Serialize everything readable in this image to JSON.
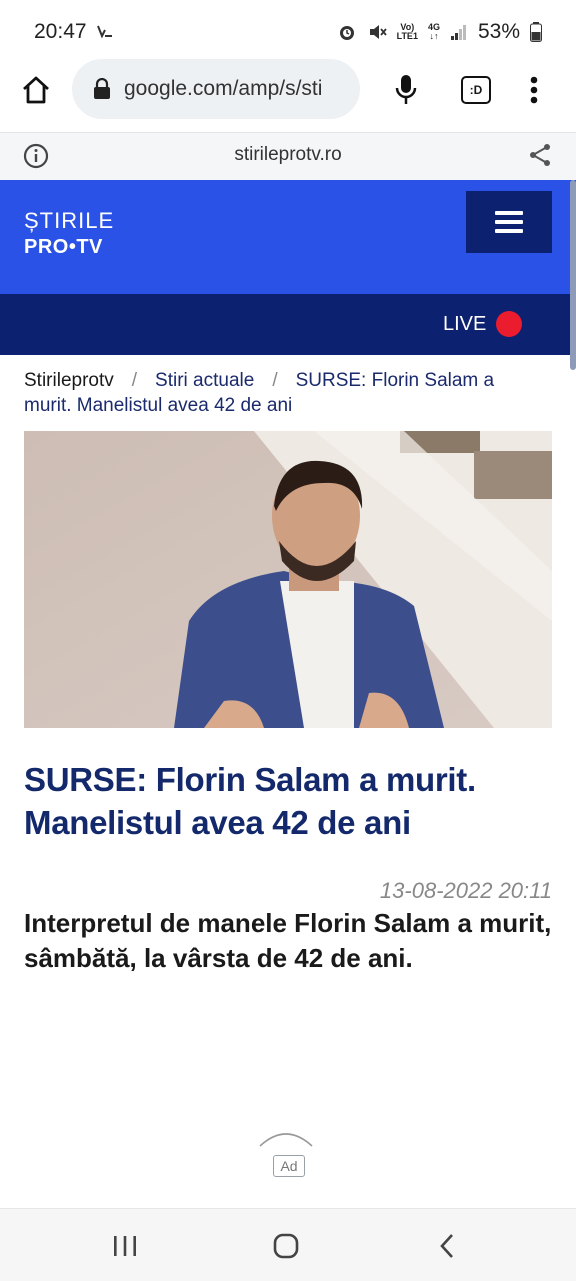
{
  "status_bar": {
    "time": "20:47",
    "network_top": "Vo)",
    "network_bottom": "LTE1",
    "data_type": "4G",
    "battery": "53%"
  },
  "browser": {
    "url": "google.com/amp/s/sti",
    "tab_label": ":D",
    "amp_domain": "stirileprotv.ro"
  },
  "site": {
    "logo_line1": "ȘTIRILE",
    "logo_line2": "PRO•TV",
    "live_label": "LIVE",
    "brand_color": "#2b52e6",
    "navy_color": "#0c2170",
    "live_color": "#ea1c2d"
  },
  "breadcrumb": {
    "items": [
      "Stirileprotv",
      "Stiri actuale",
      "SURSE: Florin Salam a murit. Manelistul avea 42 de ani"
    ],
    "separator": "/"
  },
  "article": {
    "headline": "SURSE: Florin Salam a murit. Manelistul avea 42 de ani",
    "timestamp": "13-08-2022 20:11",
    "lead": "Interpretul de manele Florin Salam a murit, sâmbătă, la vârsta de 42 de ani."
  },
  "ad": {
    "label": "Ad"
  }
}
